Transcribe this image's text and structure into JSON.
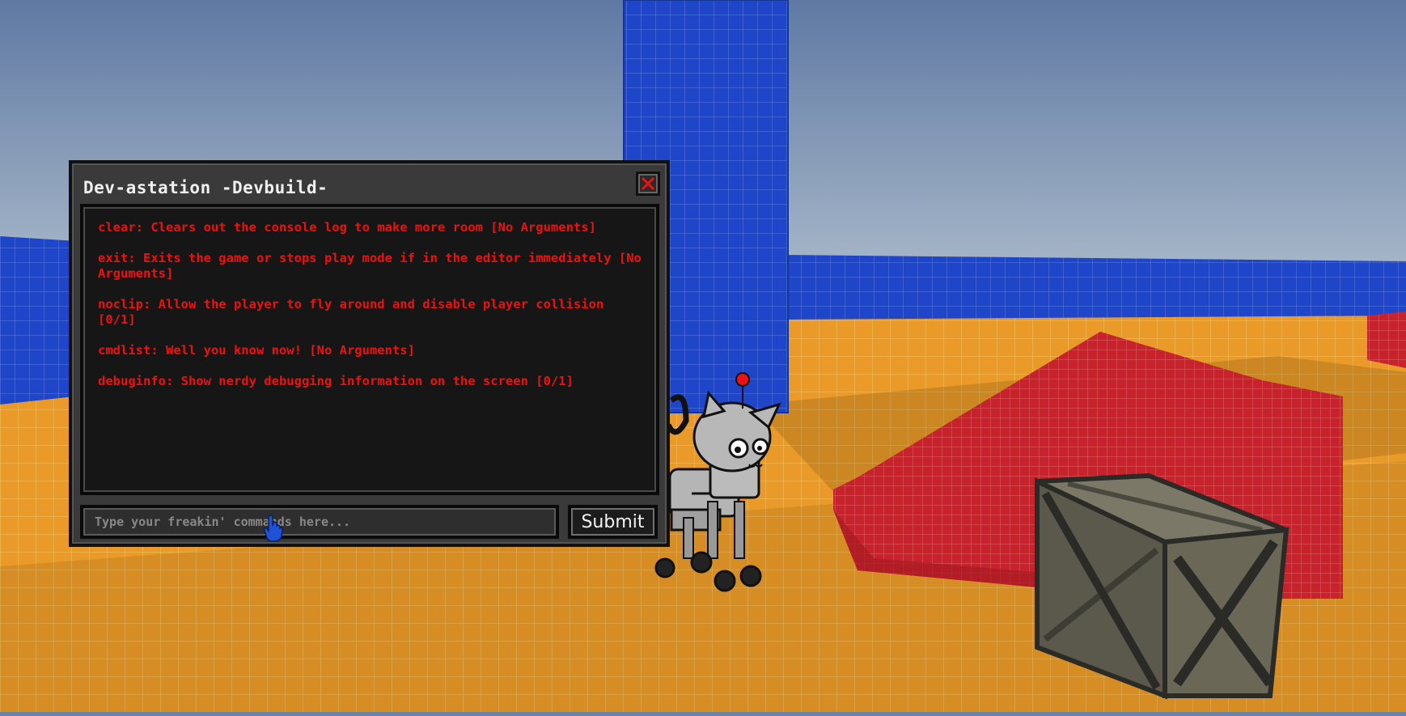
{
  "console": {
    "title": "Dev-astation -Devbuild-",
    "log": [
      "clear: Clears out the console log to make more room [No Arguments]",
      "exit: Exits the game or stops play mode if in the editor immediately [No Arguments]",
      "noclip: Allow the player to fly around and disable player collision [0/1]",
      "cmdlist: Well you know now! [No Arguments]",
      "debuginfo: Show nerdy debugging information on the screen [0/1]"
    ],
    "input_placeholder": "Type your freakin' commands here...",
    "input_value": "",
    "submit_label": "Submit"
  },
  "icons": {
    "close": "close-icon",
    "cursor": "hand-pointer-icon"
  },
  "colors": {
    "log_text": "#ee1111",
    "sky_top": "#5f79a3",
    "sky_bottom": "#b6c3cf",
    "floor": "#e99a28",
    "pillar": "#1f45c8",
    "stairs": "#c8232c",
    "back_wall": "#213d9e"
  }
}
